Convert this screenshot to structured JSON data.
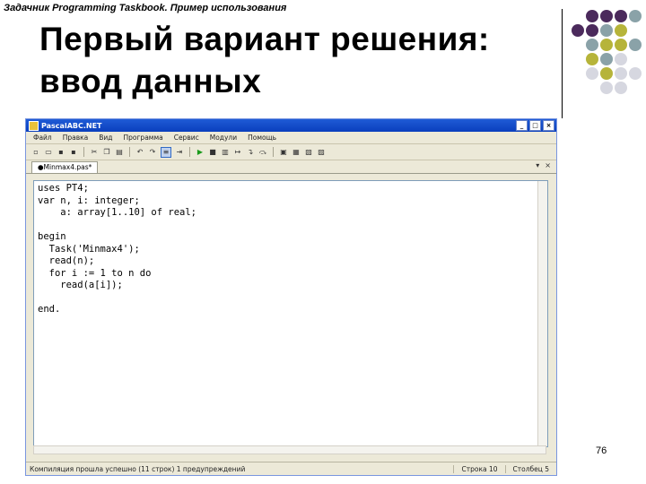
{
  "slide": {
    "header_note": "Задачник Programming Taskbook. Пример использования",
    "title_line1": "Первый вариант решения:",
    "title_line2": "ввод данных",
    "page_number": "76",
    "dot_colors": [
      "#4b2a5c",
      "#8aa2a8",
      "#b6b43a",
      "#d6d7e0"
    ]
  },
  "ide": {
    "window_title": "PascalABC.NET",
    "menu": [
      "Файл",
      "Правка",
      "Вид",
      "Программа",
      "Сервис",
      "Модули",
      "Помощь"
    ],
    "tab_label": "●Minmax4.pas*",
    "code_lines": [
      "uses PT4;",
      "var n, i: integer;",
      "    a: array[1..10] of real;",
      "",
      "begin",
      "  Task('Minmax4');",
      "  read(n);",
      "  for i := 1 to n do",
      "    read(a[i]);",
      "",
      "end."
    ],
    "status": {
      "message": "Компиляция прошла успешно (11 строк)  1 предупреждений",
      "line": "Строка  10",
      "column": "Столбец  5"
    }
  }
}
